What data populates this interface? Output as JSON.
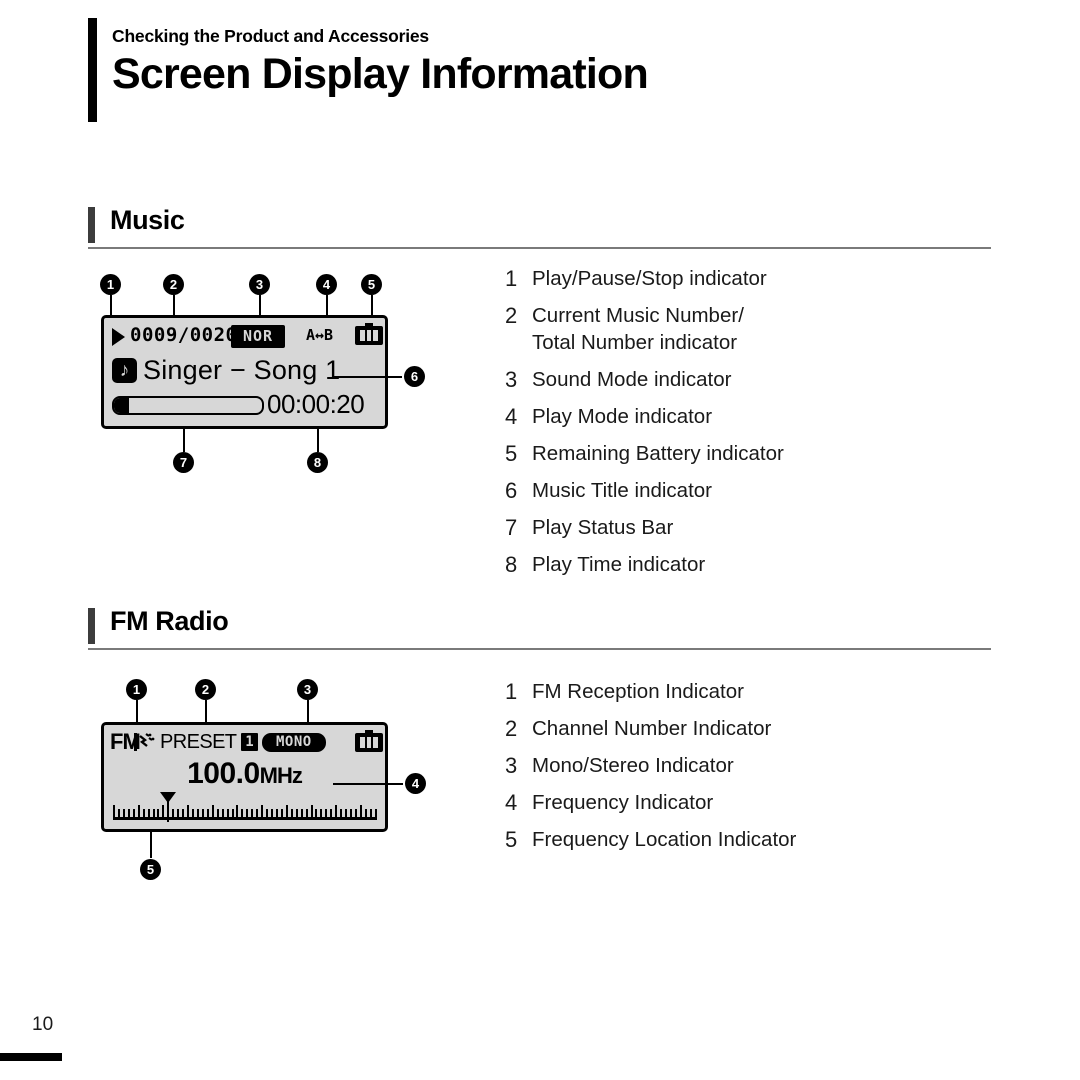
{
  "header": {
    "breadcrumb": "Checking the Product and Accessories",
    "title": "Screen Display Information"
  },
  "sections": {
    "music": {
      "heading": "Music",
      "screen": {
        "play_indicator_icon": "play-triangle-icon",
        "track_numbers": "0009/0020",
        "sound_mode": "NOR",
        "play_mode": "A↔B",
        "battery_icon": "battery-full-icon",
        "battery_segments": 3,
        "note_icon": "music-note-icon",
        "music_title": "Singer − Song 1",
        "play_status_percent": 10,
        "play_time": "00:00:20"
      },
      "callouts": [
        "1",
        "2",
        "3",
        "4",
        "5",
        "6",
        "7",
        "8"
      ],
      "legend": [
        {
          "num": "1",
          "text": "Play/Pause/Stop indicator"
        },
        {
          "num": "2",
          "text": "Current Music Number/\nTotal Number indicator"
        },
        {
          "num": "3",
          "text": "Sound Mode indicator"
        },
        {
          "num": "4",
          "text": "Play Mode indicator"
        },
        {
          "num": "5",
          "text": "Remaining Battery indicator"
        },
        {
          "num": "6",
          "text": "Music Title indicator"
        },
        {
          "num": "7",
          "text": "Play Status Bar"
        },
        {
          "num": "8",
          "text": "Play Time indicator"
        }
      ]
    },
    "fm": {
      "heading": "FM Radio",
      "screen": {
        "fm_label": "FM",
        "reception_icon": "antenna-reception-icon",
        "preset_label": "PRESET",
        "channel_number": "1",
        "mono_stereo": "MONO",
        "battery_icon": "battery-full-icon",
        "battery_segments": 3,
        "frequency_value": "100.0",
        "frequency_unit": "MHz",
        "pointer_icon": "tuning-pointer-icon"
      },
      "callouts": [
        "1",
        "2",
        "3",
        "4",
        "5"
      ],
      "legend": [
        {
          "num": "1",
          "text": "FM Reception Indicator"
        },
        {
          "num": "2",
          "text": "Channel Number Indicator"
        },
        {
          "num": "3",
          "text": "Mono/Stereo Indicator"
        },
        {
          "num": "4",
          "text": "Frequency Indicator"
        },
        {
          "num": "5",
          "text": "Frequency Location Indicator"
        }
      ]
    }
  },
  "footer": {
    "page_number": "10"
  }
}
